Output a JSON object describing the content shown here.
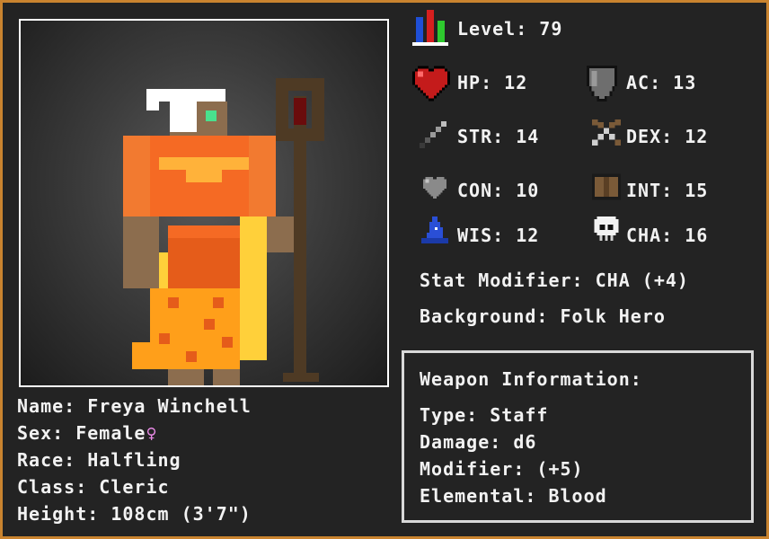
{
  "character": {
    "name_label": "Name: Freya Winchell",
    "sex_label": "Sex: Female",
    "sex_symbol": "♀",
    "race_label": "Race: Halfling",
    "class_label": "Class: Cleric",
    "height_label": "Height: 108cm (3'7\")"
  },
  "stats": {
    "level_label": "Level: 79",
    "hp_label": "HP: 12",
    "ac_label": "AC: 13",
    "str_label": "STR: 14",
    "dex_label": "DEX: 12",
    "con_label": "CON: 10",
    "int_label": "INT: 15",
    "wis_label": "WIS: 12",
    "cha_label": "CHA: 16",
    "modifier_label": "Stat Modifier: CHA (+4)",
    "background_label": "Background: Folk Hero"
  },
  "weapon": {
    "header": "Weapon Information:",
    "type_label": "Type: Staff",
    "damage_label": "Damage: d6",
    "modifier_label": "Modifier: (+5)",
    "elemental_label": "Elemental: Blood"
  },
  "icons": [
    "bar-chart-icon",
    "heart-icon",
    "shield-icon",
    "sword-icon",
    "bow-icon",
    "gray-heart-icon",
    "book-icon",
    "wizard-hat-icon",
    "skull-icon"
  ],
  "colors": {
    "border": "#c9832f",
    "background": "#232323",
    "text": "#f2f2f2",
    "sex_symbol": "#e98ae6"
  }
}
